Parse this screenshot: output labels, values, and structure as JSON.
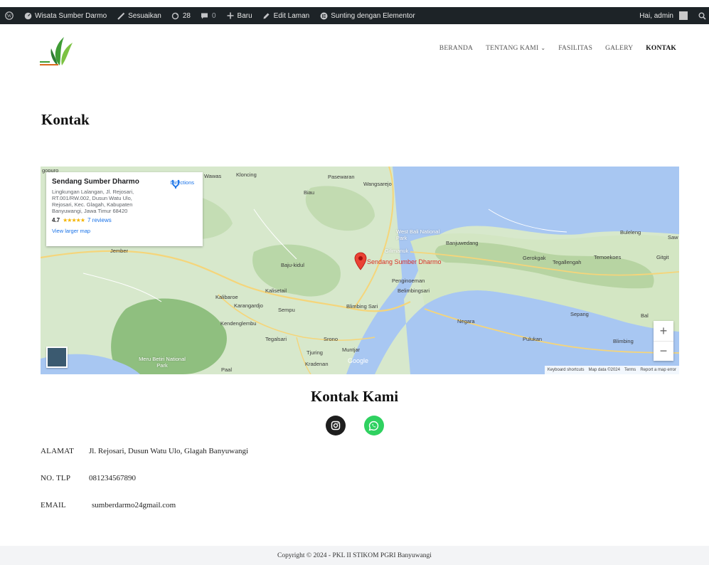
{
  "adminbar": {
    "site_name": "Wisata Sumber Darmo",
    "customize": "Sesuaikan",
    "updates_count": "28",
    "comments_count": "0",
    "new_label": "Baru",
    "edit_page": "Edit Laman",
    "elementor": "Sunting dengan Elementor",
    "greeting": "Hai, admin"
  },
  "nav": {
    "items": [
      {
        "label": "Beranda",
        "active": false
      },
      {
        "label": "Tentang Kami",
        "active": false,
        "dropdown": true
      },
      {
        "label": "Fasilitas",
        "active": false
      },
      {
        "label": "Galery",
        "active": false
      },
      {
        "label": "Kontak",
        "active": true
      }
    ]
  },
  "page": {
    "title": "Kontak"
  },
  "map": {
    "place_name": "Sendang Sumber Dharmo",
    "address": "Lingkungan Lalangan, Jl. Rejosari, RT.001/RW.002, Dusun Watu Ulo, Rejosari, Kec. Glagah, Kabupaten Banyuwangi, Jawa Timur 68420",
    "rating": "4.7",
    "stars": "★★★★★",
    "reviews": "7 reviews",
    "view_larger": "View larger map",
    "directions": "Directions",
    "pin_label": "Sendang Sumber Dharmo",
    "google": "Google",
    "attribution": [
      "Keyboard shortcuts",
      "Map data ©2024",
      "Terms",
      "Report a map error"
    ],
    "labels": {
      "gopuro": "gopuro",
      "kloncing": "Kloncing",
      "wawas": "Wawas",
      "pasewaran": "Pasewaran",
      "wangsarejo": "Wangsarejo",
      "biau": "Biau",
      "jember": "Jember",
      "west_bali": "West Bali National Park",
      "banjuwedang": "Banjuwedang",
      "gilimanuk": "Gilimanuk",
      "buleleng": "Buleleng",
      "saw": "Saw",
      "gerokgak": "Gerokgak",
      "tegallengah": "Tegallengah",
      "temoekoes": "Temoekoes",
      "gitgit": "Gitgit",
      "bajukidul": "Baju-kidul",
      "penginoeman": "Penginoeman",
      "belimbingsari": "Belimbingsari",
      "kalibaroe": "Kalibaroe",
      "kalisetail": "Kalisetail",
      "karangardjo": "Karangardjo",
      "sempu": "Sempu",
      "blimbingsari2": "Blimbing Sari",
      "kendenglembu": "Kendenglembu",
      "negara": "Negara",
      "sepang": "Sepang",
      "bal": "Bal",
      "tegalsari": "Tegalsari",
      "srono": "Srono",
      "pulukan": "Pulukan",
      "blimbing": "Blimbing",
      "meru_betiri": "Meru Betiri National Park",
      "tjuring": "Tjuring",
      "muntjar": "Muntjar",
      "kradenan": "Kradenan",
      "paal": "Paal"
    }
  },
  "contact": {
    "heading": "Kontak Kami",
    "rows": [
      {
        "label": "Alamat",
        "value": "Jl. Rejosari, Dusun Watu Ulo, Glagah Banyuwangi"
      },
      {
        "label": "No. Tlp",
        "value": "081234567890"
      },
      {
        "label": "Email",
        "value": "sumberdarmo24gmail.com"
      }
    ]
  },
  "footer": {
    "text": "Copyright © 2024 - PKL II STIKOM PGRI Banyuwangi"
  },
  "colors": {
    "adminbar": "#1d2327",
    "whatsapp": "#2fd160",
    "instagram": "#1e1e1e",
    "footer_bg": "#f3f4f6"
  }
}
